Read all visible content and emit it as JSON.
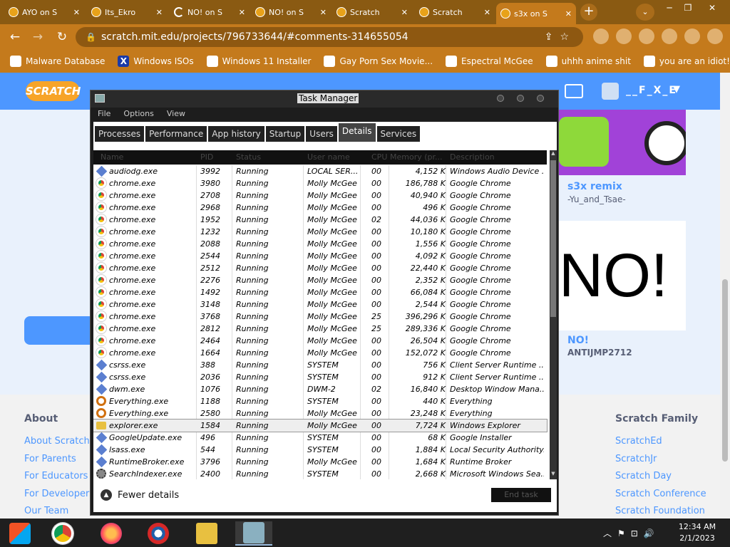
{
  "browser": {
    "tabs": [
      {
        "label": "AYO on S",
        "active": false
      },
      {
        "label": "Its_Ekro",
        "active": false
      },
      {
        "label": "NO! on S",
        "active": false,
        "loading": true
      },
      {
        "label": "NO! on S",
        "active": false
      },
      {
        "label": "Scratch",
        "active": false
      },
      {
        "label": "Scratch",
        "active": false
      },
      {
        "label": "s3x on S",
        "active": true
      }
    ],
    "url": "scratch.mit.edu/projects/796733644/#comments-314655054",
    "bookmarks": [
      {
        "label": "Malware Database",
        "icon": "malware-icon"
      },
      {
        "label": "Windows ISOs",
        "icon": "x-icon"
      },
      {
        "label": "Windows 11 Installer",
        "icon": "image-icon"
      },
      {
        "label": "Gay Porn Sex Movie...",
        "icon": "site-icon"
      },
      {
        "label": "Espectral McGee",
        "icon": "avatar-icon"
      },
      {
        "label": "uhhh anime shit",
        "icon": "anime-icon"
      },
      {
        "label": "you are an idiot!",
        "icon": "flag-icon"
      }
    ],
    "accent": "#c47a1c"
  },
  "scratch": {
    "logo": "SCRATCH",
    "username": "__F_X_E",
    "cards": [
      {
        "title": "s3x remix",
        "author": "-Yu_and_Tsae-"
      },
      {
        "big": "NO!",
        "title": "NO!",
        "author": "ANTIJMP2712"
      }
    ],
    "footer": {
      "about_head": "About",
      "about_links": [
        "About Scratch",
        "For Parents",
        "For Educators",
        "For Developers",
        "Our Team"
      ],
      "family_head": "Scratch Family",
      "family_links": [
        "ScratchEd",
        "ScratchJr",
        "Scratch Day",
        "Scratch Conference",
        "Scratch Foundation"
      ]
    },
    "brand_color": "#4d97ff"
  },
  "taskmgr": {
    "title": "Task Manager",
    "menu": [
      "File",
      "Options",
      "View"
    ],
    "tabs": [
      "Processes",
      "Performance",
      "App history",
      "Startup",
      "Users",
      "Details",
      "Services"
    ],
    "active_tab": "Details",
    "columns": [
      "Name",
      "PID",
      "Status",
      "User name",
      "CPU",
      "Memory (pr...",
      "Description"
    ],
    "rows": [
      {
        "icon": "diamond",
        "name": "audiodg.exe",
        "pid": "3992",
        "status": "Running",
        "user": "LOCAL SER...",
        "cpu": "00",
        "mem": "4,152 K",
        "desc": "Windows Audio Device ..."
      },
      {
        "icon": "chrome",
        "name": "chrome.exe",
        "pid": "3980",
        "status": "Running",
        "user": "Molly McGee",
        "cpu": "00",
        "mem": "186,788 K",
        "desc": "Google Chrome"
      },
      {
        "icon": "chrome",
        "name": "chrome.exe",
        "pid": "2708",
        "status": "Running",
        "user": "Molly McGee",
        "cpu": "00",
        "mem": "40,940 K",
        "desc": "Google Chrome"
      },
      {
        "icon": "chrome",
        "name": "chrome.exe",
        "pid": "2968",
        "status": "Running",
        "user": "Molly McGee",
        "cpu": "00",
        "mem": "496 K",
        "desc": "Google Chrome"
      },
      {
        "icon": "chrome",
        "name": "chrome.exe",
        "pid": "1952",
        "status": "Running",
        "user": "Molly McGee",
        "cpu": "02",
        "mem": "44,036 K",
        "desc": "Google Chrome"
      },
      {
        "icon": "chrome",
        "name": "chrome.exe",
        "pid": "1232",
        "status": "Running",
        "user": "Molly McGee",
        "cpu": "00",
        "mem": "10,180 K",
        "desc": "Google Chrome"
      },
      {
        "icon": "chrome",
        "name": "chrome.exe",
        "pid": "2088",
        "status": "Running",
        "user": "Molly McGee",
        "cpu": "00",
        "mem": "1,556 K",
        "desc": "Google Chrome"
      },
      {
        "icon": "chrome",
        "name": "chrome.exe",
        "pid": "2544",
        "status": "Running",
        "user": "Molly McGee",
        "cpu": "00",
        "mem": "4,092 K",
        "desc": "Google Chrome"
      },
      {
        "icon": "chrome",
        "name": "chrome.exe",
        "pid": "2512",
        "status": "Running",
        "user": "Molly McGee",
        "cpu": "00",
        "mem": "22,440 K",
        "desc": "Google Chrome"
      },
      {
        "icon": "chrome",
        "name": "chrome.exe",
        "pid": "2276",
        "status": "Running",
        "user": "Molly McGee",
        "cpu": "00",
        "mem": "2,352 K",
        "desc": "Google Chrome"
      },
      {
        "icon": "chrome",
        "name": "chrome.exe",
        "pid": "1492",
        "status": "Running",
        "user": "Molly McGee",
        "cpu": "00",
        "mem": "66,084 K",
        "desc": "Google Chrome"
      },
      {
        "icon": "chrome",
        "name": "chrome.exe",
        "pid": "3148",
        "status": "Running",
        "user": "Molly McGee",
        "cpu": "00",
        "mem": "2,544 K",
        "desc": "Google Chrome"
      },
      {
        "icon": "chrome",
        "name": "chrome.exe",
        "pid": "3768",
        "status": "Running",
        "user": "Molly McGee",
        "cpu": "25",
        "mem": "396,296 K",
        "desc": "Google Chrome"
      },
      {
        "icon": "chrome",
        "name": "chrome.exe",
        "pid": "2812",
        "status": "Running",
        "user": "Molly McGee",
        "cpu": "25",
        "mem": "289,336 K",
        "desc": "Google Chrome"
      },
      {
        "icon": "chrome",
        "name": "chrome.exe",
        "pid": "2464",
        "status": "Running",
        "user": "Molly McGee",
        "cpu": "00",
        "mem": "26,504 K",
        "desc": "Google Chrome"
      },
      {
        "icon": "chrome",
        "name": "chrome.exe",
        "pid": "1664",
        "status": "Running",
        "user": "Molly McGee",
        "cpu": "00",
        "mem": "152,072 K",
        "desc": "Google Chrome"
      },
      {
        "icon": "diamond",
        "name": "csrss.exe",
        "pid": "388",
        "status": "Running",
        "user": "SYSTEM",
        "cpu": "00",
        "mem": "756 K",
        "desc": "Client Server Runtime ..."
      },
      {
        "icon": "diamond",
        "name": "csrss.exe",
        "pid": "2036",
        "status": "Running",
        "user": "SYSTEM",
        "cpu": "00",
        "mem": "912 K",
        "desc": "Client Server Runtime ..."
      },
      {
        "icon": "diamond",
        "name": "dwm.exe",
        "pid": "1076",
        "status": "Running",
        "user": "DWM-2",
        "cpu": "02",
        "mem": "16,840 K",
        "desc": "Desktop Window Mana..."
      },
      {
        "icon": "search",
        "name": "Everything.exe",
        "pid": "1188",
        "status": "Running",
        "user": "SYSTEM",
        "cpu": "00",
        "mem": "440 K",
        "desc": "Everything"
      },
      {
        "icon": "search",
        "name": "Everything.exe",
        "pid": "2580",
        "status": "Running",
        "user": "Molly McGee",
        "cpu": "00",
        "mem": "23,248 K",
        "desc": "Everything"
      },
      {
        "icon": "folder",
        "name": "explorer.exe",
        "pid": "1584",
        "status": "Running",
        "user": "Molly McGee",
        "cpu": "00",
        "mem": "7,724 K",
        "desc": "Windows Explorer",
        "selected": true
      },
      {
        "icon": "diamond",
        "name": "GoogleUpdate.exe",
        "pid": "496",
        "status": "Running",
        "user": "SYSTEM",
        "cpu": "00",
        "mem": "68 K",
        "desc": "Google Installer"
      },
      {
        "icon": "diamond",
        "name": "lsass.exe",
        "pid": "544",
        "status": "Running",
        "user": "SYSTEM",
        "cpu": "00",
        "mem": "1,884 K",
        "desc": "Local Security Authority..."
      },
      {
        "icon": "diamond",
        "name": "RuntimeBroker.exe",
        "pid": "3796",
        "status": "Running",
        "user": "Molly McGee",
        "cpu": "00",
        "mem": "1,684 K",
        "desc": "Runtime Broker"
      },
      {
        "icon": "gear",
        "name": "SearchIndexer.exe",
        "pid": "2400",
        "status": "Running",
        "user": "SYSTEM",
        "cpu": "00",
        "mem": "2,668 K",
        "desc": "Microsoft Windows Sea..."
      }
    ],
    "fewer_details": "Fewer details",
    "end_task": "End task"
  },
  "taskbar": {
    "time": "12:34 AM",
    "date": "2/1/2023",
    "apps": [
      "windows-icon",
      "chrome-icon",
      "firefox-icon",
      "obama-icon",
      "file-explorer-icon",
      "task-manager-icon"
    ]
  }
}
